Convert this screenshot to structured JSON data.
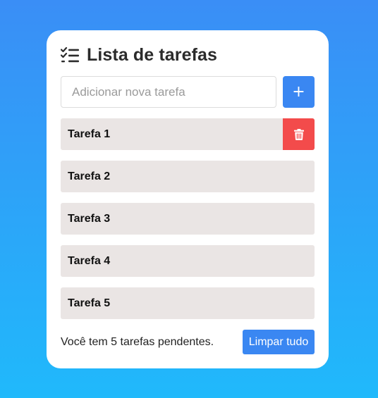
{
  "header": {
    "title": "Lista de tarefas",
    "icon": "checklist-icon"
  },
  "new_task": {
    "value": "",
    "placeholder": "Adicionar nova tarefa",
    "add_label": "+"
  },
  "tasks": [
    {
      "label": "Tarefa 1",
      "show_delete": true
    },
    {
      "label": "Tarefa 2",
      "show_delete": false
    },
    {
      "label": "Tarefa 3",
      "show_delete": false
    },
    {
      "label": "Tarefa 4",
      "show_delete": false
    },
    {
      "label": "Tarefa 5",
      "show_delete": false
    }
  ],
  "footer": {
    "pending_text": "Você tem 5 tarefas pendentes.",
    "clear_label": "Limpar tudo"
  },
  "colors": {
    "accent": "#3a87f2",
    "danger": "#f34b4b",
    "task_bg": "#eae5e4",
    "bg_top": "#3a8ef6",
    "bg_bottom": "#20b9fb"
  }
}
